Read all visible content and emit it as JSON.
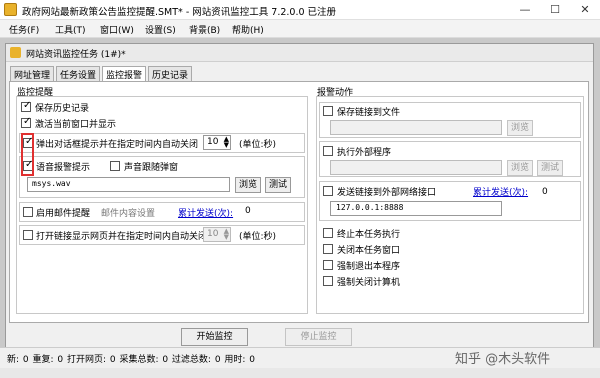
{
  "window": {
    "title": "政府网站最新政策公告监控提醒.SMT* - 网站资讯监控工具 7.2.0.0 已注册"
  },
  "menu": [
    "任务(F)",
    "工具(T)",
    "窗口(W)",
    "设置(S)",
    "背景(B)",
    "帮助(H)"
  ],
  "child_window": {
    "title": "网站资讯监控任务 (1#)*"
  },
  "tabs": [
    "网址管理",
    "任务设置",
    "监控报警",
    "历史记录"
  ],
  "left": {
    "group_title": "监控提醒",
    "save_history": "保存历史记录",
    "activate_window": "激活当前窗口并显示",
    "popup_dialog": "弹出对话框提示并在指定时间内自动关闭",
    "popup_seconds": "10",
    "popup_unit": "(单位:秒)",
    "voice_alert": "语音报警提示",
    "voice_follow": "声音跟随弹窗",
    "sound_file": "msys.wav",
    "browse": "浏览",
    "test": "测试",
    "enable_email": "启用邮件提醒",
    "email_settings": "邮件内容设置",
    "sent_total_label": "累计发送(次):",
    "sent_total_value": "0",
    "open_link": "打开链接显示网页并在指定时间内自动关闭",
    "open_seconds": "10",
    "open_unit": "(单位:秒)"
  },
  "right": {
    "group_title": "报警动作",
    "save_link": "保存链接到文件",
    "browse": "浏览",
    "run_program": "执行外部程序",
    "test": "测试",
    "send_link": "发送链接到外部网络接口",
    "sent_total_label": "累计发送(次):",
    "sent_total_value": "0",
    "endpoint": "127.0.0.1:8888",
    "terminate_task": "终止本任务执行",
    "close_window": "关闭本任务窗口",
    "force_exit": "强制退出本程序",
    "force_shutdown": "强制关闭计算机"
  },
  "buttons": {
    "start": "开始监控",
    "stop": "停止监控"
  },
  "status": "新: 0  重复: 0  打开网页: 0  采集总数: 0  过滤总数: 0  用时: 0",
  "watermark": "知乎 @木头软件"
}
